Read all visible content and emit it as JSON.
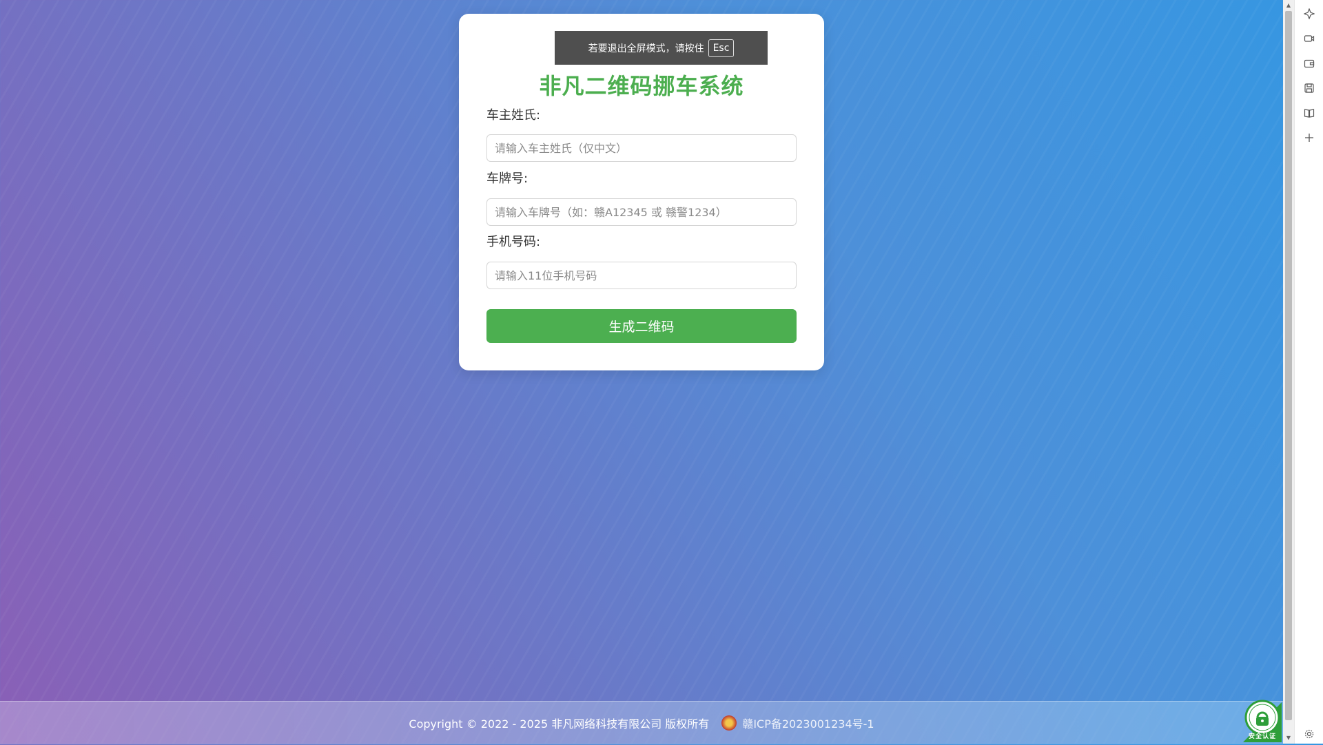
{
  "app": {
    "title": "非凡二维码挪车系统"
  },
  "form": {
    "surname_label": "车主姓氏:",
    "surname_placeholder": "请输入车主姓氏（仅中文）",
    "plate_label": "车牌号:",
    "plate_placeholder": "请输入车牌号（如：赣A12345 或 赣警1234）",
    "phone_label": "手机号码:",
    "phone_placeholder": "请输入11位手机号码",
    "submit_label": "生成二维码"
  },
  "fullscreen_toast": {
    "text": "若要退出全屏模式，请按住",
    "key": "Esc"
  },
  "footer": {
    "copyright": "Copyright © 2022 - 2025 非凡网络科技有限公司 版权所有",
    "icp": "赣ICP备2023001234号-1"
  },
  "badge": {
    "icon": "security-certification-badge",
    "label": "安全认证"
  },
  "side_panel": {
    "icons": [
      "copilot-icon",
      "video-icon",
      "wallet-icon",
      "save-icon",
      "reader-icon",
      "add-icon",
      "settings-icon"
    ]
  },
  "colors": {
    "accent": "#4caf50",
    "title": "#4cae4f"
  }
}
